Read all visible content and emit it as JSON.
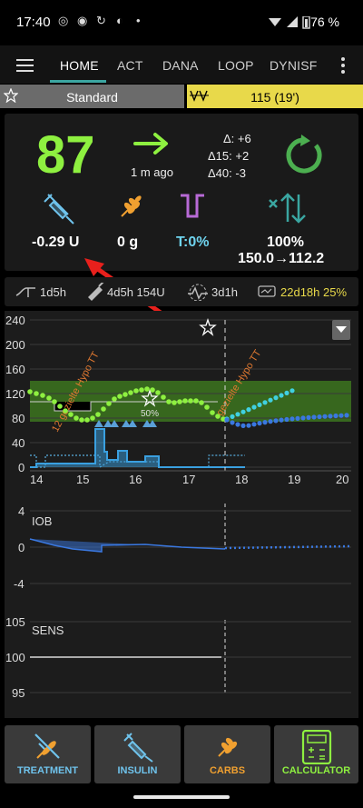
{
  "status": {
    "time": "17:40",
    "battery": "76 %"
  },
  "tabs": [
    "HOME",
    "ACT",
    "DANA",
    "LOOP",
    "DYNISF"
  ],
  "profile": {
    "name": "Standard"
  },
  "temp_target": {
    "value": "115 (19')"
  },
  "bg": {
    "value": "87",
    "ago": "1 m ago",
    "delta": "Δ: +6",
    "delta15": "Δ15: +2",
    "delta40": "Δ40:  -3",
    "color": "#8ef040"
  },
  "iob": {
    "value": "-0.29 U"
  },
  "cob": {
    "value": "0 g"
  },
  "temp_basal": {
    "value": "T:0%"
  },
  "autosens": {
    "percent": "100%",
    "isf": "150.0→112.2"
  },
  "pump": {
    "cannula_age": "1d5h",
    "insulin_age": "4d5h 154U",
    "sensor_age": "3d1h",
    "battery": "22d18h 25%"
  },
  "bg_graph": {
    "y_ticks": [
      "240",
      "200",
      "160",
      "120",
      "80",
      "40",
      "0"
    ],
    "x_ticks": [
      "14",
      "15",
      "16",
      "17",
      "18",
      "19",
      "20"
    ],
    "annotation_left": "12 gezielte Hypo TT",
    "annotation_right": "gezielte Hypo TT",
    "smb_label": "50%"
  },
  "iob_graph": {
    "label": "IOB",
    "y_ticks": [
      "4",
      "0",
      "-4"
    ]
  },
  "sens_graph": {
    "label": "SENS",
    "y_ticks": [
      "105",
      "100",
      "95"
    ]
  },
  "buttons": {
    "treatment": "TREATMENT",
    "insulin": "INSULIN",
    "carbs": "CARBS",
    "calculator": "CALCULATOR"
  },
  "colors": {
    "bg_in_range": "#8ef040",
    "prediction_cyan": "#40d0e0",
    "prediction_blue": "#3a78e0",
    "target_band": "#3f7a1f",
    "temp_target": "#e8d94a",
    "accent": "#3ba6a1",
    "iob_color": "#6fc3ec",
    "carbs_color": "#f0a030",
    "arrow_annotation": "#e8201c"
  },
  "icons": [
    "menu-icon",
    "more-icon",
    "star-icon",
    "temp-target-icon",
    "trend-arrow-icon",
    "loop-icon",
    "syringe-icon",
    "carbs-icon",
    "temp-basal-icon",
    "autosens-icon",
    "cannula-icon",
    "insulin-icon",
    "sensor-icon",
    "battery-icon",
    "calculator-icon"
  ]
}
